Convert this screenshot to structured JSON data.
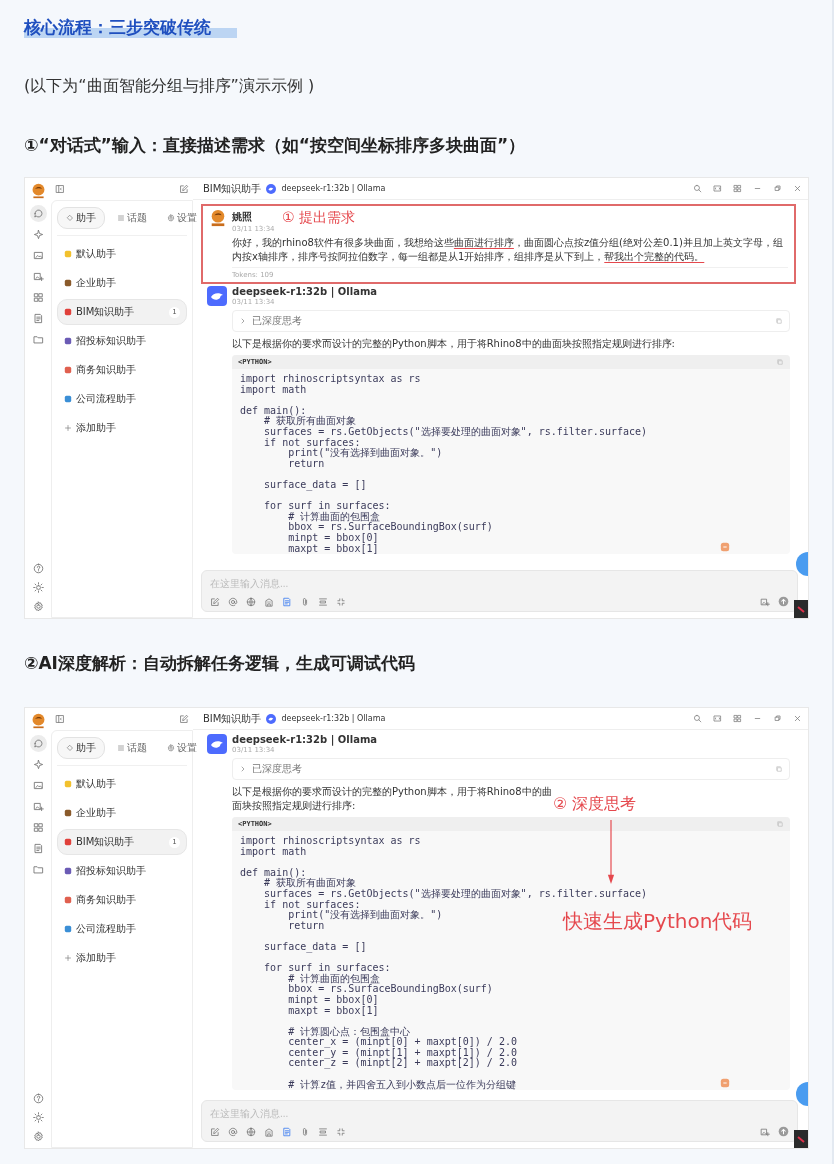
{
  "heading": "核心流程：三步突破传统",
  "intro": "(以下为“曲面智能分组与排序”演示示例 )",
  "steps": [
    {
      "title": "①“对话式”输入：直接描述需求（如“按空间坐标排序多块曲面”）",
      "app": {
        "rail": [
          {
            "selected": true
          },
          {
            "selected": false
          },
          {
            "selected": false
          },
          {
            "selected": false
          },
          {
            "selected": false
          },
          {
            "selected": false
          },
          {
            "selected": false
          }
        ],
        "tabs": [
          {
            "label": "助手",
            "selected": true
          },
          {
            "label": "话题",
            "selected": false
          },
          {
            "label": "设置",
            "selected": false
          }
        ],
        "assistants": [
          {
            "name": "默认助手",
            "color": "#f2c12e",
            "selected": false
          },
          {
            "name": "企业助手",
            "color": "#8a5a2b",
            "selected": false
          },
          {
            "name": "BIM知识助手",
            "color": "#e0403a",
            "selected": true,
            "count": "1"
          },
          {
            "name": "招投标知识助手",
            "color": "#6b5bb5",
            "selected": false
          },
          {
            "name": "商务知识助手",
            "color": "#e0604f",
            "selected": false
          },
          {
            "name": "公司流程助手",
            "color": "#3b8fd6",
            "selected": false
          }
        ],
        "add_assistant": "添加助手",
        "header": {
          "assistant": "BIM知识助手",
          "model": "deepseek-r1:32b | Ollama"
        },
        "messages": [
          {
            "kind": "user",
            "author": "姚照",
            "time": "03/11 13:34",
            "highlighted": true,
            "callout": "① 提出需求",
            "segments": [
              {
                "text": "你好，我的rhino8软件有很多块曲面，我想给这些",
                "underlined": false
              },
              {
                "text": "曲面进行排序",
                "underlined": true
              },
              {
                "text": "，曲面圆心点按z值分组(绝对公差0.1)并且加上英文字母，组内按x轴排序，排序号按阿拉伯数字，每一组都是从1开始排序，组排序是从下到上，",
                "underlined": false
              },
              {
                "text": "帮我出个完整的代码。",
                "underlined": true
              }
            ],
            "tokens": "Tokens: 109"
          },
          {
            "kind": "assistant",
            "author": "deepseek-r1:32b | Ollama",
            "time": "03/11 13:34",
            "thinking": {
              "label": "已深度思考",
              "expanded": false
            },
            "intro": "以下是根据你的要求而设计的完整的Python脚本，用于将Rhino8中的曲面块按照指定规则进行排序:",
            "code_lang": "<PYTHON>",
            "code": "import rhinoscriptsyntax as rs\nimport math\n\ndef main():\n    # 获取所有曲面对象\n    surfaces = rs.GetObjects(\"选择要处理的曲面对象\", rs.filter.surface)\n    if not surfaces:\n        print(\"没有选择到曲面对象。\")\n        return\n\n    surface_data = []\n\n    for surf in surfaces:\n        # 计算曲面的包围盒\n        bbox = rs.SurfaceBoundingBox(surf)\n        minpt = bbox[0]\n        maxpt = bbox[1]"
          }
        ],
        "input": {
          "placeholder": "在这里输入消息...",
          "knowledge_on": true
        }
      }
    },
    {
      "title": "②AI深度解析：自动拆解任务逻辑，生成可调试代码",
      "app": {
        "rail": [
          {
            "selected": true
          },
          {
            "selected": false
          },
          {
            "selected": false
          },
          {
            "selected": false
          },
          {
            "selected": false
          },
          {
            "selected": false
          },
          {
            "selected": false
          }
        ],
        "tabs": [
          {
            "label": "助手",
            "selected": true
          },
          {
            "label": "话题",
            "selected": false
          },
          {
            "label": "设置",
            "selected": false
          }
        ],
        "assistants": [
          {
            "name": "默认助手",
            "color": "#f2c12e",
            "selected": false
          },
          {
            "name": "企业助手",
            "color": "#8a5a2b",
            "selected": false
          },
          {
            "name": "BIM知识助手",
            "color": "#e0403a",
            "selected": true,
            "count": "1"
          },
          {
            "name": "招投标知识助手",
            "color": "#6b5bb5",
            "selected": false
          },
          {
            "name": "商务知识助手",
            "color": "#e0604f",
            "selected": false
          },
          {
            "name": "公司流程助手",
            "color": "#3b8fd6",
            "selected": false
          }
        ],
        "add_assistant": "添加助手",
        "header": {
          "assistant": "BIM知识助手",
          "model": "deepseek-r1:32b | Ollama"
        },
        "messages": [
          {
            "kind": "assistant",
            "author": "deepseek-r1:32b | Ollama",
            "time": "03/11 13:34",
            "thinking": {
              "label": "已深度思考",
              "expanded": false
            },
            "intro": "以下是根据你的要求而设计的完整的Python脚本，用于将Rhino8中的曲面块按照指定规则进行排序:",
            "code_lang": "<PYTHON>",
            "code": "import rhinoscriptsyntax as rs\nimport math\n\ndef main():\n    # 获取所有曲面对象\n    surfaces = rs.GetObjects(\"选择要处理的曲面对象\", rs.filter.surface)\n    if not surfaces:\n        print(\"没有选择到曲面对象。\")\n        return\n\n    surface_data = []\n\n    for surf in surfaces:\n        # 计算曲面的包围盒\n        bbox = rs.SurfaceBoundingBox(surf)\n        minpt = bbox[0]\n        maxpt = bbox[1]\n\n        # 计算圆心点：包围盒中心\n        center_x = (minpt[0] + maxpt[0]) / 2.0\n        center_y = (minpt[1] + maxpt[1]) / 2.0\n        center_z = (minpt[2] + maxpt[2]) / 2.0\n\n        # 计算z值，并四舍五入到小数点后一位作为分组键"
          }
        ],
        "annotations": [
          {
            "kind": "label",
            "text": "② 深度思考"
          },
          {
            "kind": "arrow"
          },
          {
            "kind": "headline",
            "text": "快速生成Python代码"
          }
        ],
        "input": {
          "placeholder": "在这里输入消息...",
          "knowledge_on": true
        }
      }
    }
  ]
}
